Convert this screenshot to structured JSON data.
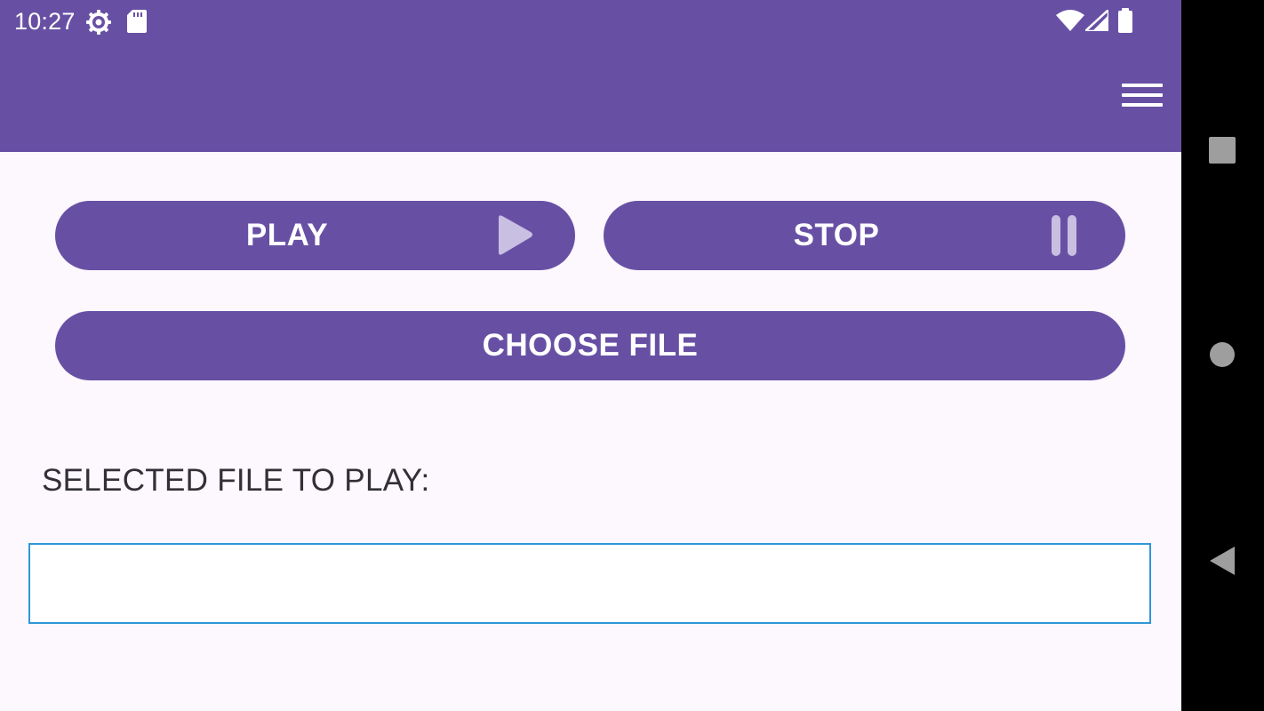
{
  "status_bar": {
    "time": "10:27",
    "icons": [
      "settings-gear-icon",
      "sd-card-icon",
      "wifi-icon",
      "cellular-signal-icon",
      "battery-icon"
    ]
  },
  "app_bar": {
    "menu_icon": "hamburger-menu-icon"
  },
  "controls": {
    "play_label": "PLAY",
    "play_icon": "play-icon",
    "stop_label": "STOP",
    "stop_icon": "pause-icon",
    "choose_file_label": "CHOOSE FILE"
  },
  "selection": {
    "label": "SELECTED FILE TO PLAY:",
    "file_value": ""
  },
  "nav_bar": {
    "buttons": [
      "recents-square-icon",
      "home-circle-icon",
      "back-triangle-icon"
    ]
  },
  "colors": {
    "primary": "#6750a4",
    "background": "#fdf7fe",
    "icon_tint": "#c9bfe2",
    "field_border": "#2f97d6",
    "nav_background": "#000000"
  }
}
